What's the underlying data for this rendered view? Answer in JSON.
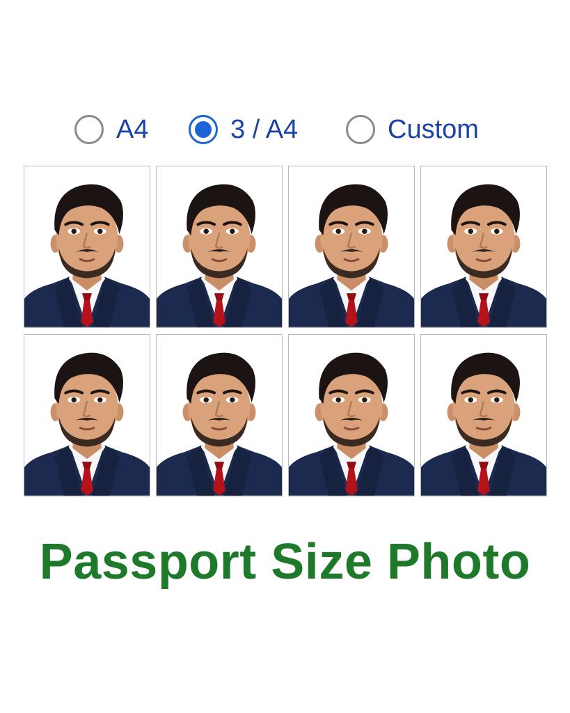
{
  "size_options": [
    {
      "label": "A4",
      "selected": false
    },
    {
      "label": "3 / A4",
      "selected": true
    },
    {
      "label": "Custom",
      "selected": false
    }
  ],
  "photos": {
    "count": 8,
    "subject": "passport portrait, man in navy suit with white shirt and red tie"
  },
  "title": "Passport Size Photo",
  "colors": {
    "radio_selected": "#1a64d6",
    "option_text": "#1a43a8",
    "title": "#1e7a2a",
    "suit": "#1b2a4e",
    "tie": "#b5121b"
  }
}
